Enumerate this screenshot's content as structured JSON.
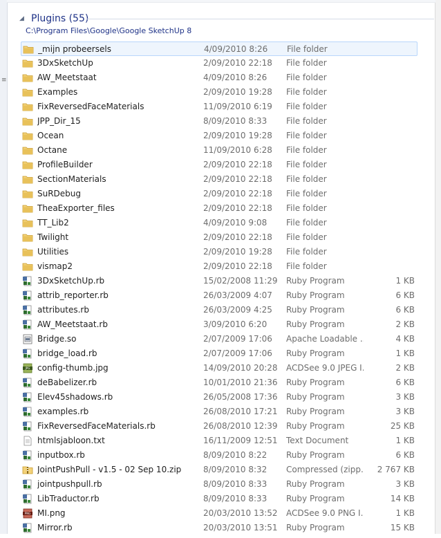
{
  "group": {
    "title": "Plugins (55)",
    "path": "C:\\Program Files\\Google\\Google SketchUp 8"
  },
  "icon_colors": {
    "folder": "#e8c15a",
    "accent_blue": "#1e3287",
    "selection": "#cce4fb"
  },
  "files": [
    {
      "name": "_mijn probeersels",
      "date": "4/09/2010 8:26",
      "type": "File folder",
      "size": "",
      "icon": "folder-icon",
      "selected": true
    },
    {
      "name": "3DxSketchUp",
      "date": "2/09/2010 22:18",
      "type": "File folder",
      "size": "",
      "icon": "folder-icon"
    },
    {
      "name": "AW_Meetstaat",
      "date": "4/09/2010 8:26",
      "type": "File folder",
      "size": "",
      "icon": "folder-icon"
    },
    {
      "name": "Examples",
      "date": "2/09/2010 19:28",
      "type": "File folder",
      "size": "",
      "icon": "folder-icon"
    },
    {
      "name": "FixReversedFaceMaterials",
      "date": "11/09/2010 6:19",
      "type": "File folder",
      "size": "",
      "icon": "folder-icon"
    },
    {
      "name": "JPP_Dir_15",
      "date": "8/09/2010 8:33",
      "type": "File folder",
      "size": "",
      "icon": "folder-icon"
    },
    {
      "name": "Ocean",
      "date": "2/09/2010 19:28",
      "type": "File folder",
      "size": "",
      "icon": "folder-icon"
    },
    {
      "name": "Octane",
      "date": "11/09/2010 6:28",
      "type": "File folder",
      "size": "",
      "icon": "folder-icon"
    },
    {
      "name": "ProfileBuilder",
      "date": "2/09/2010 22:18",
      "type": "File folder",
      "size": "",
      "icon": "folder-icon"
    },
    {
      "name": "SectionMaterials",
      "date": "2/09/2010 22:18",
      "type": "File folder",
      "size": "",
      "icon": "folder-icon"
    },
    {
      "name": "SuRDebug",
      "date": "2/09/2010 22:18",
      "type": "File folder",
      "size": "",
      "icon": "folder-icon"
    },
    {
      "name": "TheaExporter_files",
      "date": "2/09/2010 22:18",
      "type": "File folder",
      "size": "",
      "icon": "folder-icon"
    },
    {
      "name": "TT_Lib2",
      "date": "4/09/2010 9:08",
      "type": "File folder",
      "size": "",
      "icon": "folder-icon"
    },
    {
      "name": "Twilight",
      "date": "2/09/2010 22:18",
      "type": "File folder",
      "size": "",
      "icon": "folder-icon"
    },
    {
      "name": "Utilities",
      "date": "2/09/2010 19:28",
      "type": "File folder",
      "size": "",
      "icon": "folder-icon"
    },
    {
      "name": "vismap2",
      "date": "2/09/2010 22:18",
      "type": "File folder",
      "size": "",
      "icon": "folder-icon"
    },
    {
      "name": "3DxSketchUp.rb",
      "date": "15/02/2008 11:29",
      "type": "Ruby Program",
      "size": "1 KB",
      "icon": "ruby-file-icon"
    },
    {
      "name": "attrib_reporter.rb",
      "date": "26/03/2009 4:07",
      "type": "Ruby Program",
      "size": "6 KB",
      "icon": "ruby-file-icon"
    },
    {
      "name": "attributes.rb",
      "date": "26/03/2009 4:25",
      "type": "Ruby Program",
      "size": "6 KB",
      "icon": "ruby-file-icon"
    },
    {
      "name": "AW_Meetstaat.rb",
      "date": "3/09/2010 6:20",
      "type": "Ruby Program",
      "size": "2 KB",
      "icon": "ruby-file-icon"
    },
    {
      "name": "Bridge.so",
      "date": "2/07/2009 17:06",
      "type": "Apache Loadable ...",
      "size": "4 KB",
      "icon": "module-file-icon"
    },
    {
      "name": "bridge_load.rb",
      "date": "2/07/2009 17:06",
      "type": "Ruby Program",
      "size": "1 KB",
      "icon": "ruby-file-icon"
    },
    {
      "name": "config-thumb.jpg",
      "date": "14/09/2010 20:28",
      "type": "ACDSee 9.0 JPEG I...",
      "size": "2 KB",
      "icon": "jpeg-file-icon"
    },
    {
      "name": "deBabelizer.rb",
      "date": "10/01/2010 21:36",
      "type": "Ruby Program",
      "size": "6 KB",
      "icon": "ruby-file-icon"
    },
    {
      "name": "Elev45shadows.rb",
      "date": "26/05/2008 17:36",
      "type": "Ruby Program",
      "size": "3 KB",
      "icon": "ruby-file-icon"
    },
    {
      "name": "examples.rb",
      "date": "26/08/2010 17:21",
      "type": "Ruby Program",
      "size": "3 KB",
      "icon": "ruby-file-icon"
    },
    {
      "name": "FixReversedFaceMaterials.rb",
      "date": "26/08/2010 12:39",
      "type": "Ruby Program",
      "size": "25 KB",
      "icon": "ruby-file-icon"
    },
    {
      "name": "htmlsjabloon.txt",
      "date": "16/11/2009 12:51",
      "type": "Text Document",
      "size": "1 KB",
      "icon": "text-file-icon"
    },
    {
      "name": "inputbox.rb",
      "date": "8/09/2010 8:22",
      "type": "Ruby Program",
      "size": "6 KB",
      "icon": "ruby-file-icon"
    },
    {
      "name": "JointPushPull - v1.5 - 02 Sep 10.zip",
      "date": "8/09/2010 8:32",
      "type": "Compressed (zipp...",
      "size": "2 767 KB",
      "icon": "zip-file-icon"
    },
    {
      "name": "jointpushpull.rb",
      "date": "8/09/2010 8:33",
      "type": "Ruby Program",
      "size": "3 KB",
      "icon": "ruby-file-icon"
    },
    {
      "name": "LibTraductor.rb",
      "date": "8/09/2010 8:33",
      "type": "Ruby Program",
      "size": "14 KB",
      "icon": "ruby-file-icon"
    },
    {
      "name": "MI.png",
      "date": "20/03/2010 13:52",
      "type": "ACDSee 9.0 PNG I...",
      "size": "1 KB",
      "icon": "png-file-icon"
    },
    {
      "name": "Mirror.rb",
      "date": "20/03/2010 13:51",
      "type": "Ruby Program",
      "size": "15 KB",
      "icon": "ruby-file-icon"
    }
  ]
}
